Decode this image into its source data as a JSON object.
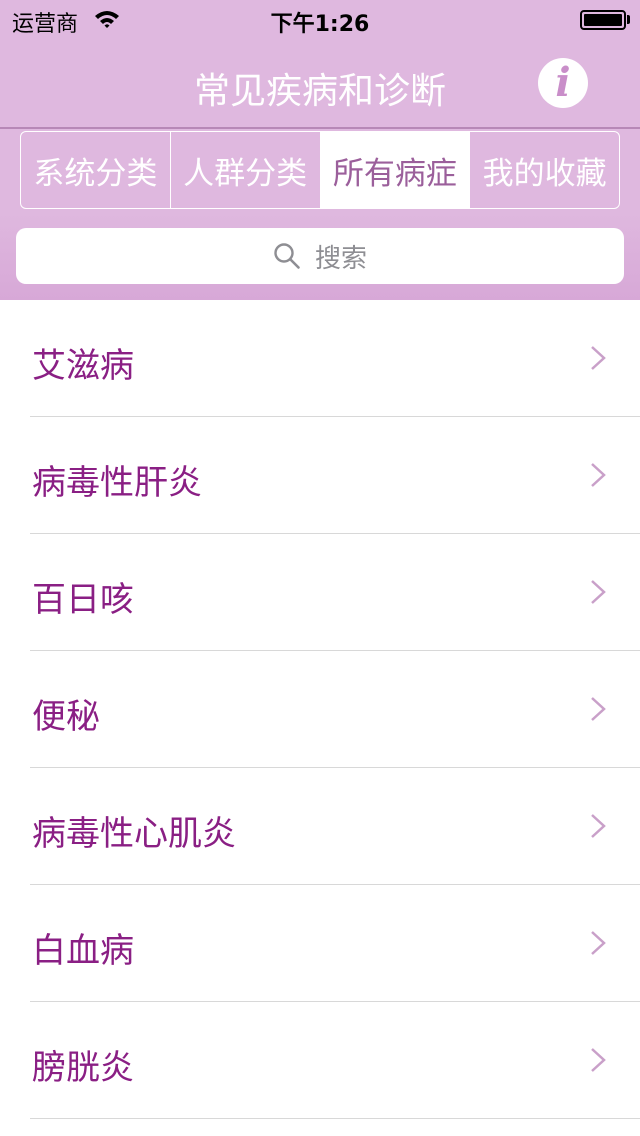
{
  "status_bar": {
    "carrier": "运营商",
    "time": "下午1:26"
  },
  "nav": {
    "title": "常见疾病和诊断",
    "info_icon": "info-icon",
    "info_glyph": "i"
  },
  "segments": [
    {
      "label": "系统分类",
      "active": false
    },
    {
      "label": "人群分类",
      "active": false
    },
    {
      "label": "所有病症",
      "active": true
    },
    {
      "label": "我的收藏",
      "active": false
    }
  ],
  "search": {
    "placeholder": "搜索",
    "icon": "search-icon"
  },
  "list": {
    "items": [
      {
        "label": "艾滋病"
      },
      {
        "label": "病毒性肝炎"
      },
      {
        "label": "百日咳"
      },
      {
        "label": "便秘"
      },
      {
        "label": "病毒性心肌炎"
      },
      {
        "label": "白血病"
      },
      {
        "label": "膀胱炎"
      }
    ]
  },
  "colors": {
    "bar": "#dfb8df",
    "accent_text": "#8a1f84",
    "active_segment_text": "#9b5f9b",
    "chevron": "#c9a0c9"
  }
}
